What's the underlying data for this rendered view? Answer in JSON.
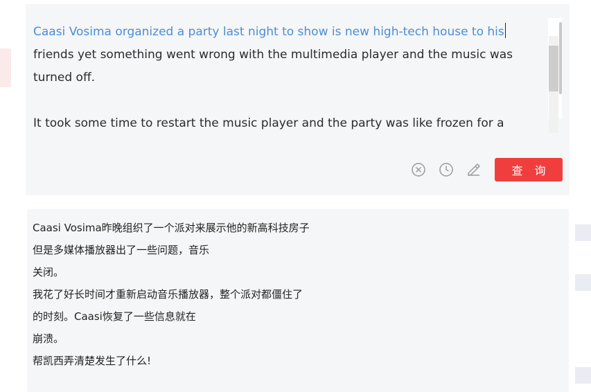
{
  "source": {
    "lines": [
      "Caasi Vosima organized a party last night to show is new high-tech house to his",
      "friends yet something went wrong with the multimedia player and the music was",
      "turned off.",
      "",
      "It took some time to restart the music player and the party was like frozen for a"
    ]
  },
  "actions": {
    "clear_icon": "circle-x-icon",
    "history_icon": "clock-icon",
    "edit_icon": "pen-icon",
    "query_label": "查 询",
    "query_color": "#f03e3e"
  },
  "result": {
    "lines": [
      "Caasi Vosima昨晚组织了一个派对来展示他的新高科技房子",
      "但是多媒体播放器出了一些问题，音乐",
      "关闭。",
      "我花了好长时间才重新启动音乐播放器，整个派对都僵住了",
      "的时刻。Caasi恢复了一些信息就在",
      "崩溃。",
      "帮凯西弄清楚发生了什么!"
    ]
  },
  "colors": {
    "highlight_text": "#4a8dd8",
    "box_background": "#f5f6f7"
  }
}
